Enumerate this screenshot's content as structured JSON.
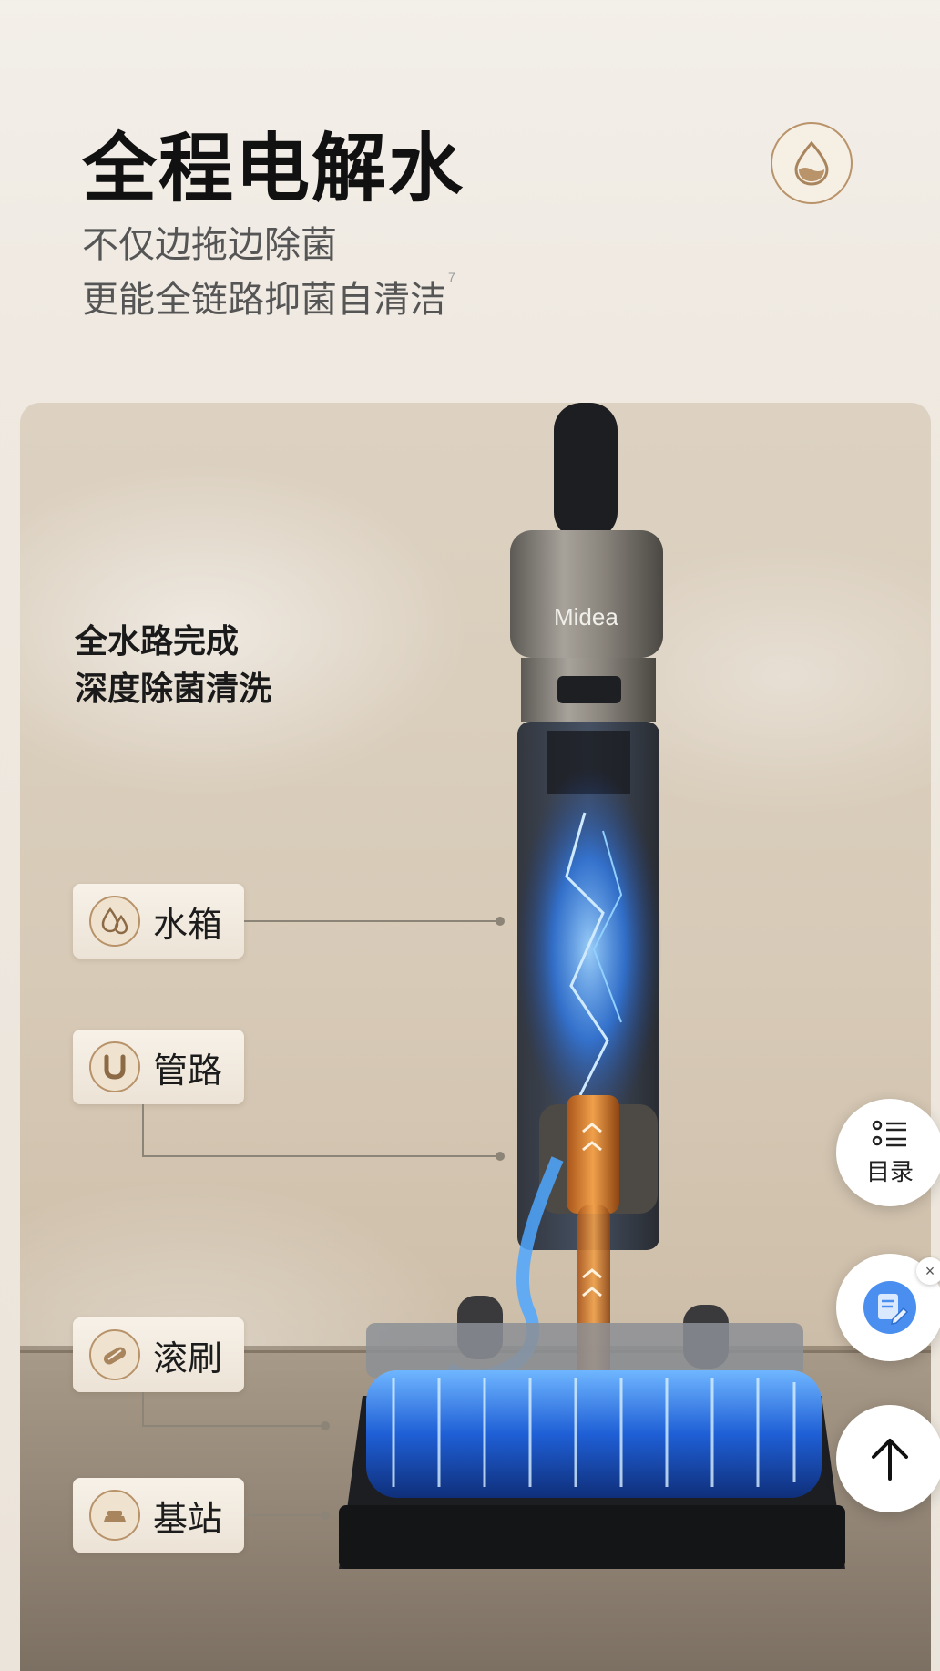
{
  "header": {
    "title": "全程电解水",
    "subtitle_line1": "不仅边拖边除菌",
    "subtitle_line2": "更能全链路抑菌自清洁",
    "footnote": "7",
    "badge_icon": "water-drop-icon"
  },
  "product": {
    "brand": "Midea",
    "callout_line1": "全水路完成",
    "callout_line2": "深度除菌清洗"
  },
  "tags": [
    {
      "label": "水箱",
      "icon": "water-drops-icon"
    },
    {
      "label": "管路",
      "icon": "pipe-icon"
    },
    {
      "label": "滚刷",
      "icon": "roller-brush-icon"
    },
    {
      "label": "基站",
      "icon": "base-station-icon"
    }
  ],
  "floating": {
    "toc_label": "目录",
    "close_symbol": "×"
  },
  "colors": {
    "accent_gold": "#b9936a",
    "water_blue": "#2f7df0",
    "pipe_orange": "#e0822a"
  }
}
